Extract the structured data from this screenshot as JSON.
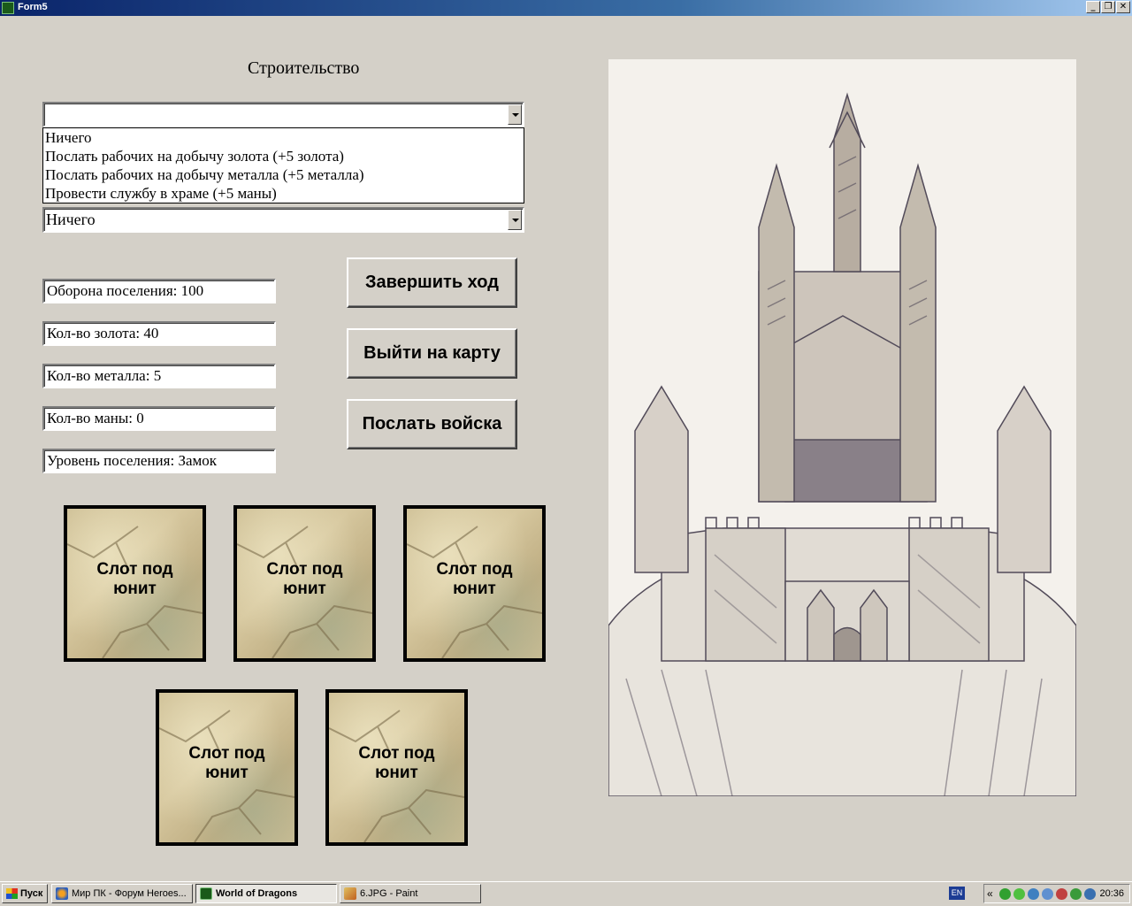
{
  "window": {
    "title": "Form5"
  },
  "heading": "Строительство",
  "combo_top": {
    "value": ""
  },
  "dropdown": {
    "options": [
      "Ничего",
      "Послать рабочих на добычу золота (+5 золота)",
      "Послать рабочих на добычу металла (+5 металла)",
      "Провести службу в храме (+5 маны)"
    ]
  },
  "combo_bottom": {
    "value": "Ничего"
  },
  "fields": {
    "defense": "Оборона поселения: 100",
    "gold": "Кол-во золота: 40",
    "metal": "Кол-во металла: 5",
    "mana": "Кол-во маны: 0",
    "level": "Уровень поселения: Замок"
  },
  "buttons": {
    "end_turn": "Завершить ход",
    "exit_map": "Выйти на карту",
    "send_troops": "Послать войска"
  },
  "slots": [
    {
      "line1": "Слот под",
      "line2": "юнит"
    },
    {
      "line1": "Слот под",
      "line2": "юнит"
    },
    {
      "line1": "Слот под",
      "line2": "юнит"
    },
    {
      "line1": "Слот под",
      "line2": "юнит"
    },
    {
      "line1": "Слот под",
      "line2": "юнит"
    }
  ],
  "taskbar": {
    "start": "Пуск",
    "tasks": [
      {
        "label": "Мир ПК - Форум Heroes...",
        "icon": "firefox-icon",
        "active": false
      },
      {
        "label": "World of Dragons",
        "icon": "app-icon",
        "active": true
      },
      {
        "label": "6.JPG - Paint",
        "icon": "paint-icon",
        "active": false
      }
    ],
    "lang": "EN",
    "tray_chevron": "«",
    "clock": "20:36"
  }
}
